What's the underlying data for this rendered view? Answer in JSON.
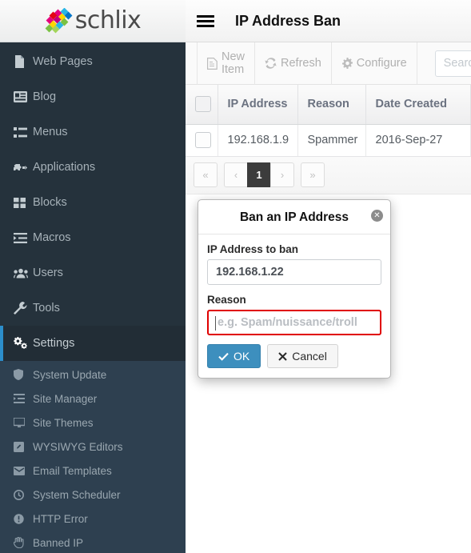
{
  "brand": {
    "name": "schlix",
    "logo_icon": "schlix-dots-logo"
  },
  "sidebar": {
    "items": [
      {
        "label": "Web Pages",
        "icon": "file-icon"
      },
      {
        "label": "Blog",
        "icon": "newspaper-icon"
      },
      {
        "label": "Menus",
        "icon": "list-icon"
      },
      {
        "label": "Applications",
        "icon": "puzzle-icon"
      },
      {
        "label": "Blocks",
        "icon": "grid-blocks-icon"
      },
      {
        "label": "Macros",
        "icon": "indent-list-icon"
      },
      {
        "label": "Users",
        "icon": "users-icon"
      },
      {
        "label": "Tools",
        "icon": "wrench-icon"
      },
      {
        "label": "Settings",
        "icon": "gears-icon",
        "active": true
      }
    ],
    "subitems": [
      {
        "label": "System Update",
        "icon": "shield-icon"
      },
      {
        "label": "Site Manager",
        "icon": "indent-list-icon"
      },
      {
        "label": "Site Themes",
        "icon": "monitor-icon"
      },
      {
        "label": "WYSIWYG Editors",
        "icon": "pencil-square-icon"
      },
      {
        "label": "Email Templates",
        "icon": "envelope-icon"
      },
      {
        "label": "System Scheduler",
        "icon": "clock-icon"
      },
      {
        "label": "HTTP Error",
        "icon": "exclamation-circle-icon"
      },
      {
        "label": "Banned IP",
        "icon": "hand-stop-icon"
      }
    ]
  },
  "header": {
    "menu_icon": "hamburger-icon",
    "title": "IP Address Ban"
  },
  "toolbar": {
    "new_item_label": "New Item",
    "new_item_icon": "file-icon",
    "refresh_label": "Refresh",
    "refresh_icon": "refresh-icon",
    "configure_label": "Configure",
    "configure_icon": "gear-icon",
    "search_placeholder": "Search"
  },
  "table": {
    "columns": [
      "IP Address",
      "Reason",
      "Date Created"
    ],
    "rows": [
      {
        "ip": "192.168.1.9",
        "reason": "Spammer",
        "date": "2016-Sep-27"
      }
    ]
  },
  "pagination": {
    "first": "«",
    "prev": "‹",
    "current": "1",
    "next": "›",
    "last": "»"
  },
  "modal": {
    "title": "Ban an IP Address",
    "close_icon": "close-circle-icon",
    "ip_label": "IP Address to ban",
    "ip_value": "192.168.1.22",
    "reason_label": "Reason",
    "reason_placeholder": "e.g. Spam/nuissance/troll",
    "ok_label": "OK",
    "ok_icon": "check-icon",
    "cancel_label": "Cancel",
    "cancel_icon": "x-icon"
  },
  "colors": {
    "sidebar_bg": "#25323c",
    "sidebar_sub_bg": "#2e4050",
    "accent_blue": "#2c8ecb",
    "primary_button": "#3d8fbe",
    "error_border": "#e00000",
    "pagination_active": "#3c3c3c"
  }
}
